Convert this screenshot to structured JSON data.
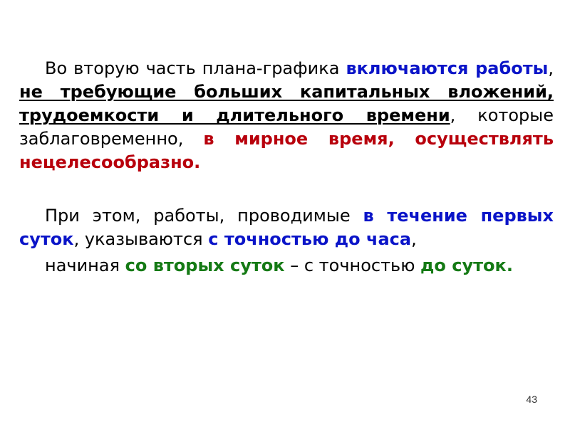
{
  "slide": {
    "page_number": "43",
    "colors": {
      "emphasis_blue": "#0a14c8",
      "emphasis_red": "#b8000c",
      "emphasis_green": "#157a15",
      "text": "#000000"
    },
    "paragraphs": [
      {
        "runs": [
          {
            "text": "Во вторую часть плана-графика ",
            "style": "normal"
          },
          {
            "text": "включаются работы",
            "style": "bold-blue"
          },
          {
            "text": ", ",
            "style": "normal"
          },
          {
            "text": "не требующие больших капитальных вложений, трудоемкости и длительного времени",
            "style": "bold-underline"
          },
          {
            "text": ", которые заблаговременно, ",
            "style": "normal"
          },
          {
            "text": "в мирное время, осуществлять нецелесообразно.",
            "style": "bold-red"
          }
        ]
      },
      {
        "runs": [
          {
            "text": "При этом, работы, проводимые ",
            "style": "normal"
          },
          {
            "text": "в течение первых суток",
            "style": "bold-blue"
          },
          {
            "text": ", указываются ",
            "style": "normal"
          },
          {
            "text": "с точностью до часа",
            "style": "bold-blue"
          },
          {
            "text": ",",
            "style": "normal"
          }
        ]
      },
      {
        "runs": [
          {
            "text": "начиная ",
            "style": "normal"
          },
          {
            "text": "со вторых суток",
            "style": "bold-green"
          },
          {
            "text": " – с точностью ",
            "style": "normal"
          },
          {
            "text": "до суток.",
            "style": "bold-green"
          }
        ]
      }
    ]
  }
}
